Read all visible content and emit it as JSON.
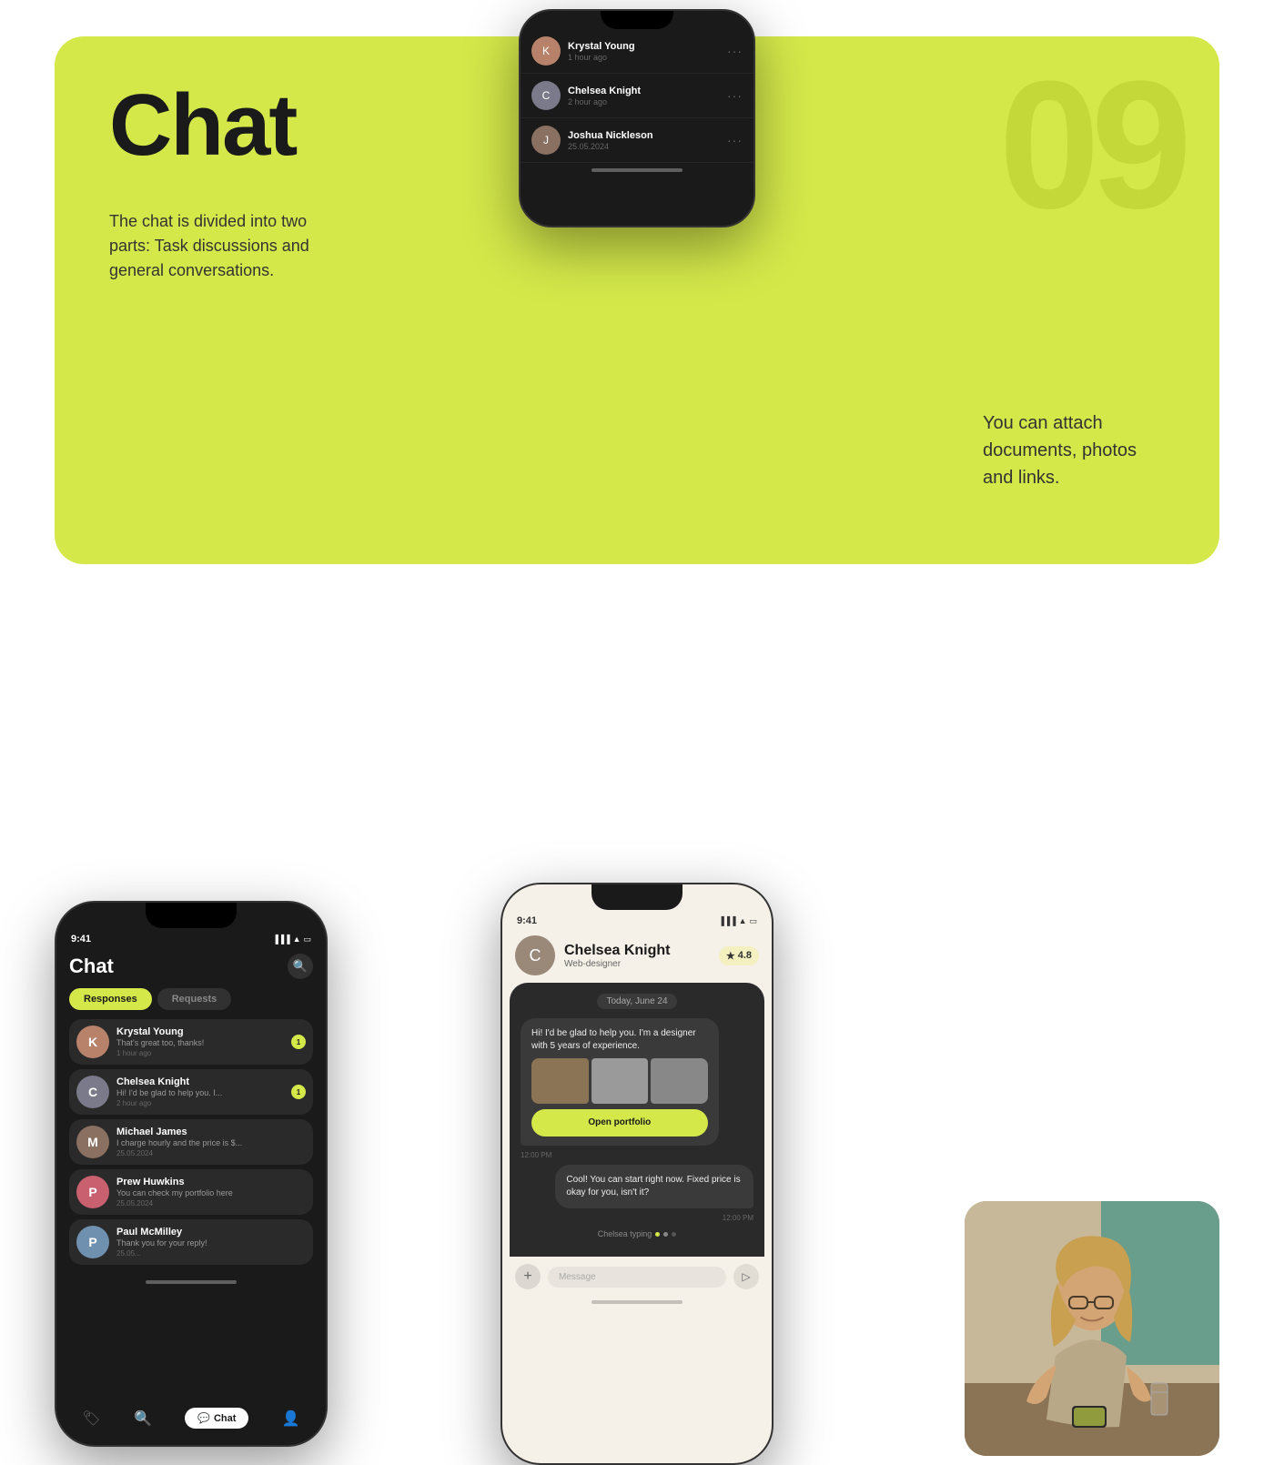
{
  "page": {
    "background": "#ffffff"
  },
  "header": {
    "title": "Chat",
    "subtitle": "The chat is divided into two parts: Task discussions and general conversations.",
    "number": "09",
    "attach_text": "You can attach documents, photos and links."
  },
  "top_phone": {
    "contacts": [
      {
        "name": "Krystal Young",
        "time": "1 hour ago"
      },
      {
        "name": "Chelsea Knight",
        "time": "2 hour ago"
      },
      {
        "name": "Joshua Nickleson",
        "time": "25.05.2024"
      }
    ]
  },
  "left_phone": {
    "status_time": "9:41",
    "screen_title": "Chat",
    "tab_responses": "Responses",
    "tab_requests": "Requests",
    "contacts": [
      {
        "name": "Krystal Young",
        "msg": "That's great too, thanks!",
        "time": "1 hour ago",
        "badge": "1",
        "avatar_color": "#b8826a"
      },
      {
        "name": "Chelsea Knight",
        "msg": "Hi! I'd be glad to help you. I...",
        "time": "2 hour ago",
        "badge": "1",
        "avatar_color": "#7a7a8a"
      },
      {
        "name": "Michael James",
        "msg": "I charge hourly and the price is $...",
        "time": "25.05.2024",
        "badge": "",
        "avatar_color": "#8a7060"
      },
      {
        "name": "Prew Huwkins",
        "msg": "You can check my portfolio here",
        "time": "25.05.2024",
        "badge": "",
        "avatar_color": "#c86070"
      },
      {
        "name": "Paul McMilley",
        "msg": "Thank you for your reply!",
        "time": "25.05...",
        "badge": "",
        "avatar_color": "#7090b0"
      }
    ],
    "nav": {
      "chat_label": "Chat"
    }
  },
  "center_phone": {
    "status_time": "9:41",
    "contact_name": "Chelsea Knight",
    "contact_role": "Web-designer",
    "rating": "4.8",
    "date_label": "Today, June 24",
    "messages": [
      {
        "type": "received",
        "text": "Hi! I'd be glad to help you. I'm a designer with 5 years of experience.",
        "time": "12:00 PM",
        "has_portfolio": true,
        "portfolio_btn": "Open portfolio"
      },
      {
        "type": "sent",
        "text": "Cool!  You can start right now. Fixed price is okay for you, isn't it?",
        "time": "12:00 PM",
        "has_portfolio": false
      }
    ],
    "typing_label": "Chelsea typing",
    "message_placeholder": "Message"
  }
}
